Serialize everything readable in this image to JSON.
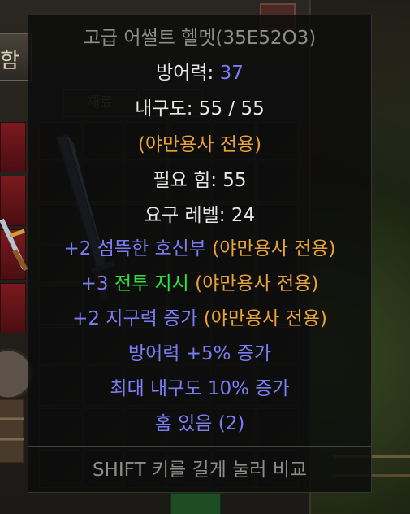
{
  "inventory": {
    "header_label": "함",
    "tab_labels": [
      "재료",
      ""
    ]
  },
  "tooltip": {
    "title": "고급 어썰트 헬멧(35E52O3)",
    "defense": {
      "label": "방어력: ",
      "value": "37"
    },
    "durability": "내구도: 55 / 55",
    "class_only": "(야만용사 전용)",
    "req_str": "필요 힘: 55",
    "req_level": "요구 레벨: 24",
    "skills": [
      {
        "bonus": "+2 섬뜩한 호신부 ",
        "tree": null,
        "tag": "(야만용사 전용)"
      },
      {
        "bonus": "+3 ",
        "tree": "전투 지시",
        "tag": " (야만용사 전용)"
      },
      {
        "bonus": "+2 지구력 증가 ",
        "tree": null,
        "tag": "(야만용사 전용)"
      }
    ],
    "mod_defense_pct": "방어력 +5% 증가",
    "mod_durability": "최대 내구도 10% 증가",
    "sockets": "홈 있음 (2)",
    "compare_hint": "SHIFT 키를 길게 눌러 비교"
  },
  "colors": {
    "magic_blue": "#7c7cf2",
    "class_gold": "#e8a23a",
    "skill_green": "#2ee041",
    "text_white": "#e8e8e8",
    "hint_gray": "#8d8d8d"
  },
  "icons": [
    "sword-icon",
    "armor-icon",
    "crossbow-icon"
  ]
}
